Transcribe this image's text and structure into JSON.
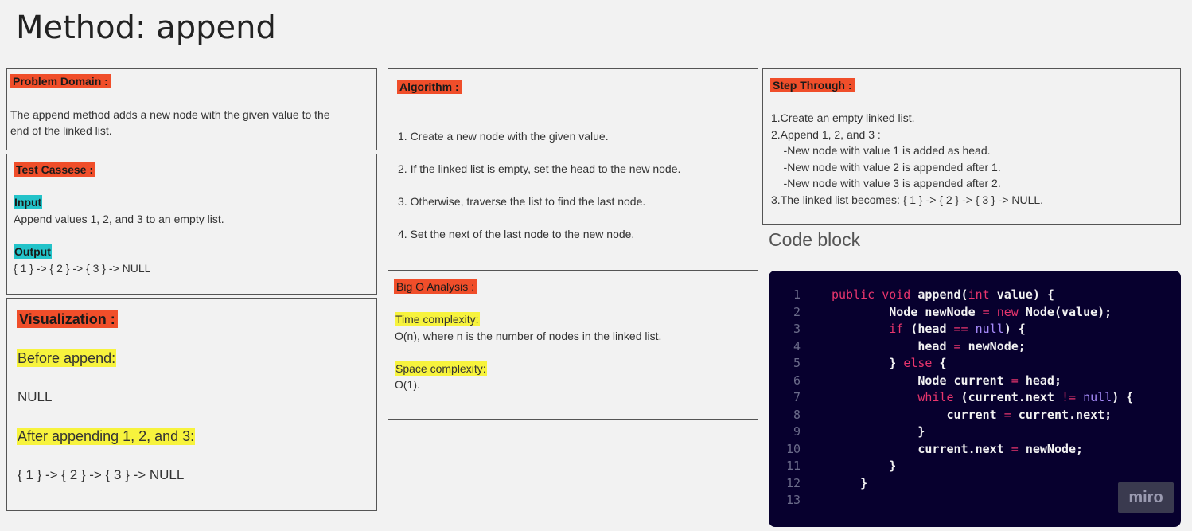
{
  "page": {
    "title": "Method: append"
  },
  "problem_domain": {
    "heading": "Problem Domain :",
    "lines": [
      "The append method adds a new node with the given value to the",
      "end of the linked list."
    ]
  },
  "test_cases": {
    "heading": "Test Cassese :",
    "input_label": "Input",
    "input_text": "Append values 1, 2, and 3 to an empty list.",
    "output_label": "Output",
    "output_text": "{ 1 } -> { 2 } -> { 3 } -> NULL"
  },
  "visualization": {
    "heading": "Visualization :",
    "before_label": "Before append:",
    "before_value": "NULL",
    "after_label": "After appending 1, 2, and 3:",
    "after_value": "{ 1 } -> { 2 } -> { 3 } -> NULL"
  },
  "algorithm": {
    "heading": "Algorithm :",
    "steps": [
      "1. Create a new node with the given value.",
      "2. If the linked list is empty, set the head to the new node.",
      "3. Otherwise, traverse the list to find the last node.",
      "4. Set the next of the last node to the new node."
    ]
  },
  "big_o": {
    "heading": "Big O Analysis :",
    "time_label": "Time complexity:",
    "time_text": "O(n), where n is the number of nodes in the linked list.",
    "space_label": "Space complexity:",
    "space_text": " O(1)."
  },
  "step_through": {
    "heading": "Step Through :",
    "lines": [
      "1.Create an empty linked list.",
      "2.Append 1, 2, and 3 :",
      "    -New node with value 1 is added as head.",
      "    -New node with value 2 is appended after 1.",
      "    -New node with value 3 is appended after 2.",
      "3.The linked list becomes: { 1 } -> { 2 } -> { 3 } -> NULL."
    ]
  },
  "code_block": {
    "label": "Code block",
    "line_numbers": [
      "1",
      "2",
      "3",
      "4",
      "5",
      "6",
      "7",
      "8",
      "9",
      "10",
      "11",
      "12",
      "13"
    ],
    "lines": [
      [
        {
          "t": "kw",
          "v": "public void "
        },
        {
          "t": "tx",
          "v": "append("
        },
        {
          "t": "ty",
          "v": "int"
        },
        {
          "t": "tx",
          "v": " value) {"
        }
      ],
      [
        {
          "t": "tx",
          "v": "        Node newNode "
        },
        {
          "t": "kw",
          "v": "="
        },
        {
          "t": "kw",
          "v": " new"
        },
        {
          "t": "tx",
          "v": " Node(value);"
        }
      ],
      [
        {
          "t": "kw",
          "v": "        if"
        },
        {
          "t": "tx",
          "v": " (head "
        },
        {
          "t": "kw",
          "v": "=="
        },
        {
          "t": "nu",
          "v": " null"
        },
        {
          "t": "tx",
          "v": ") {"
        }
      ],
      [
        {
          "t": "tx",
          "v": "            head "
        },
        {
          "t": "kw",
          "v": "="
        },
        {
          "t": "tx",
          "v": " newNode;"
        }
      ],
      [
        {
          "t": "tx",
          "v": "        } "
        },
        {
          "t": "kw",
          "v": "else"
        },
        {
          "t": "tx",
          "v": " {"
        }
      ],
      [
        {
          "t": "tx",
          "v": "            Node current "
        },
        {
          "t": "kw",
          "v": "="
        },
        {
          "t": "tx",
          "v": " head;"
        }
      ],
      [
        {
          "t": "kw",
          "v": "            while"
        },
        {
          "t": "tx",
          "v": " (current.next "
        },
        {
          "t": "kw",
          "v": "!="
        },
        {
          "t": "nu",
          "v": " null"
        },
        {
          "t": "tx",
          "v": ") {"
        }
      ],
      [
        {
          "t": "tx",
          "v": "                current "
        },
        {
          "t": "kw",
          "v": "="
        },
        {
          "t": "tx",
          "v": " current.next;"
        }
      ],
      [
        {
          "t": "tx",
          "v": "            }"
        }
      ],
      [
        {
          "t": "tx",
          "v": "            current.next "
        },
        {
          "t": "kw",
          "v": "="
        },
        {
          "t": "tx",
          "v": " newNode;"
        }
      ],
      [
        {
          "t": "tx",
          "v": "        }"
        }
      ],
      [
        {
          "t": "tx",
          "v": "    }"
        }
      ],
      [
        {
          "t": "tx",
          "v": ""
        }
      ]
    ]
  },
  "watermark": {
    "text": "miro"
  }
}
